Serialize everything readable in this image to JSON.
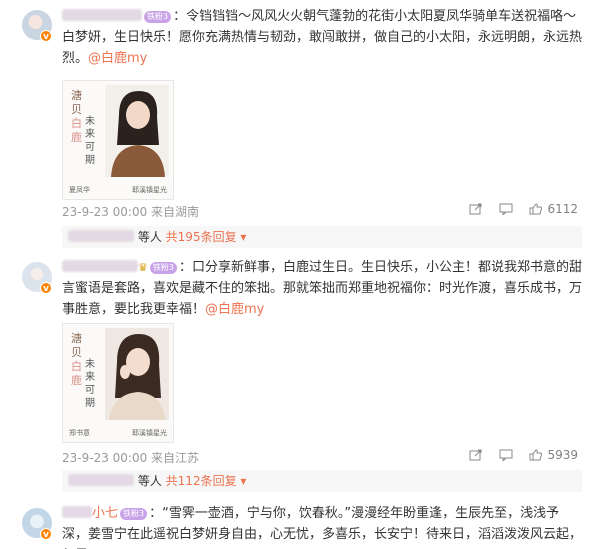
{
  "comments": [
    {
      "text": "：令铛铛铛～风风火火朝气蓬勃的花街小太阳夏凤华骑单车送祝福咯～白梦妍，生日快乐！愿你充满热情与韧劲，敢闯敢拼，做自己的小太阳，永远明朗，永远热烈。",
      "mention": "@白鹿my",
      "badge": "铁粉3",
      "poster": {
        "title_pink": "白鹿",
        "title_a": "溏",
        "title_b": "贝",
        "vert": "未来可期",
        "sign": "夏凤华",
        "footer_right": "耶溪镇星光"
      },
      "meta": "23-9-23 00:00 来自湖南",
      "likes": "6112",
      "reply_prefix": "等人",
      "reply_more": "共195条回复",
      "reply_caret": "▾"
    },
    {
      "text": "：口分享新鲜事，白鹿过生日。生日快乐，小公主！都说我郑书意的甜言蜜语是套路，喜欢是藏不住的笨拙。那就笨拙而郑重地祝福你：时光作渡，喜乐成书，万事胜意，要比我更幸福！",
      "mention": "@白鹿my",
      "badge": "铁粉3",
      "poster": {
        "title_pink": "白鹿",
        "title_a": "溏",
        "title_b": "贝",
        "vert": "未来可期",
        "sign": "郑书意",
        "footer_right": "耶溪镇星光"
      },
      "meta": "23-9-23 00:00 来自江苏",
      "likes": "5939",
      "reply_prefix": "等人",
      "reply_more": "共112条回复",
      "reply_caret": "▾"
    },
    {
      "name_tail": "小七",
      "badge": "铁粉3",
      "text": "：“雪霁一壶酒，宁与你，饮春秋。”漫漫经年盼重逢，生辰先至，浅浅予深，姜雪宁在此遥祝白梦妍身自由，心无忧，多喜乐，长安宁！待来日，滔滔泼泼风云起，与君"
    }
  ],
  "icons": {
    "share": "share-icon",
    "comment": "comment-icon",
    "like": "like-icon",
    "verified": "verified-icon"
  },
  "colors": {
    "link": "#eb7350",
    "meta": "#9a9a9a",
    "badge": "#c9a3e8"
  }
}
